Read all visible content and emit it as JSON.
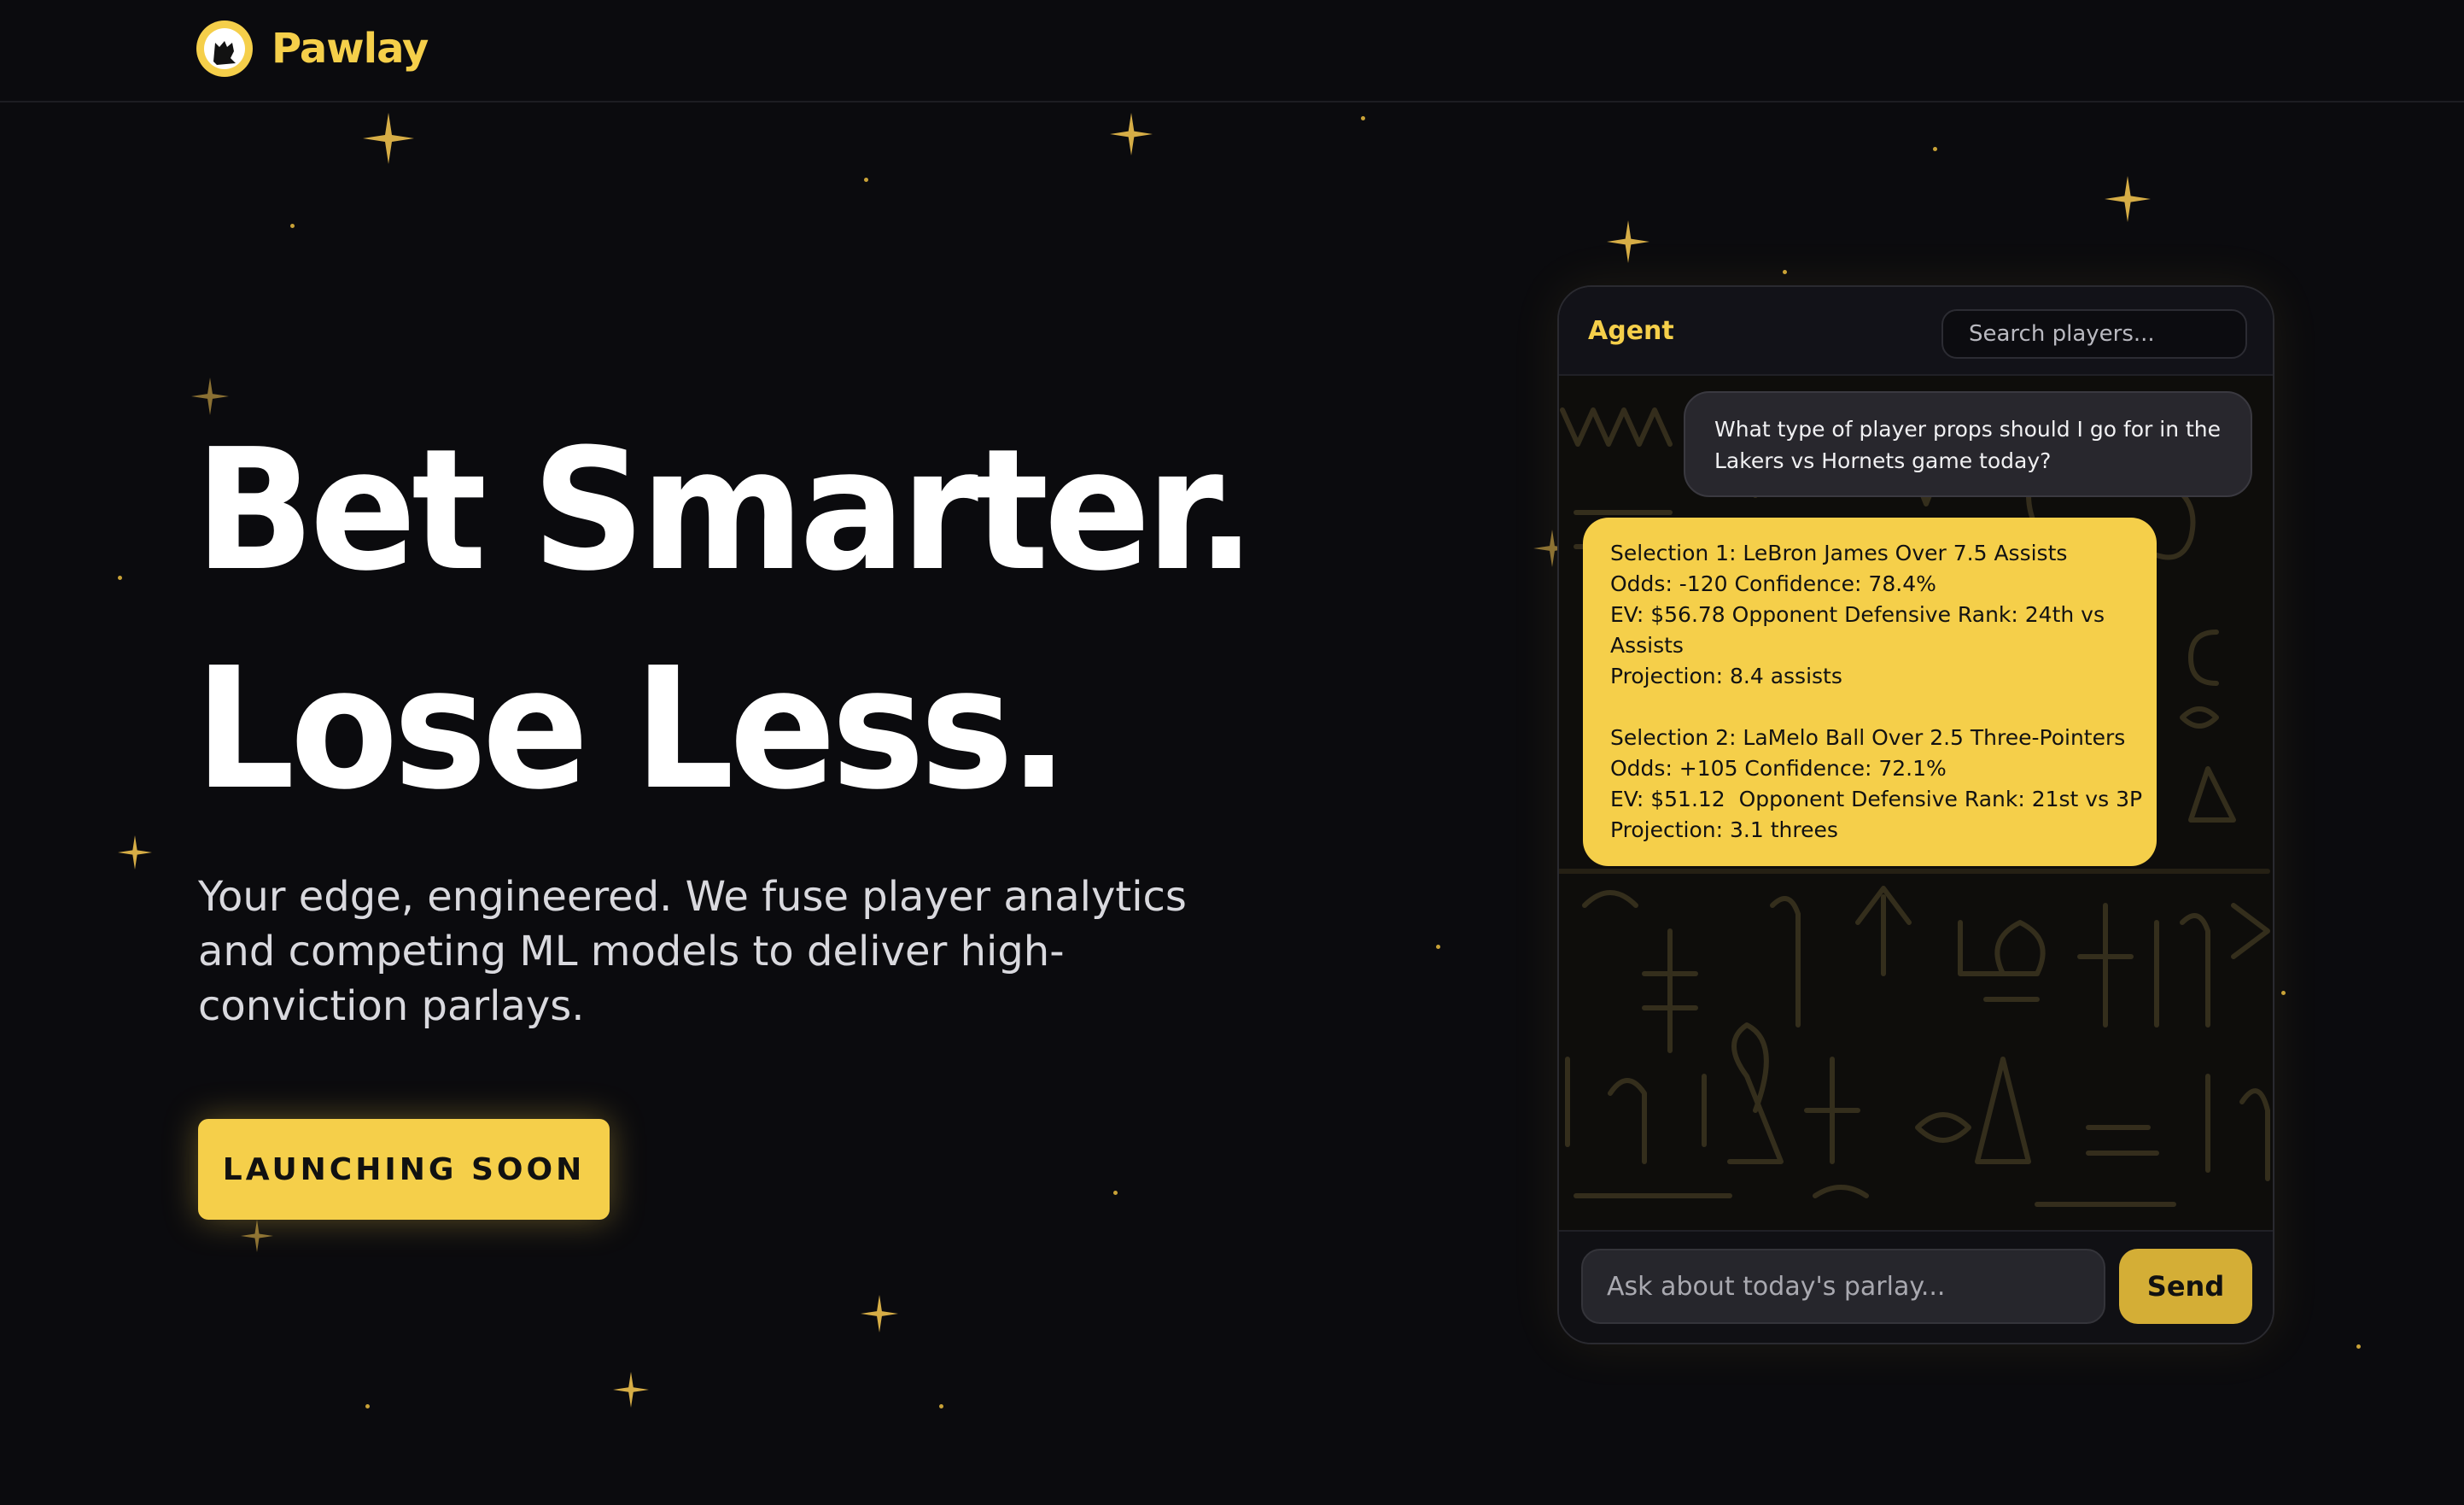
{
  "brand": {
    "name": "Pawlay",
    "logo_icon": "cat-logo-icon"
  },
  "hero": {
    "headline_line1": "Bet Smarter.",
    "headline_line2": "Lose Less.",
    "subtitle": "Your edge, engineered. We fuse player analytics and competing ML models to deliver high-conviction parlays.",
    "cta_label": "LAUNCHING SOON"
  },
  "chat": {
    "agent_label": "Agent",
    "search_placeholder": "Search players...",
    "user_message": "What type of player props should I go for in the Lakers vs Hornets game today?",
    "agent_lines": [
      "Selection 1: LeBron James Over 7.5 Assists",
      "Odds: -120 Confidence: 78.4%",
      "EV: $56.78 Opponent Defensive Rank: 24th vs",
      "Assists",
      "Projection: 8.4 assists",
      "",
      "Selection 2: LaMelo Ball Over 2.5 Three-Pointers",
      "Odds: +105 Confidence: 72.1%",
      "EV: $51.12  Opponent Defensive Rank: 21st vs 3P",
      "Projection: 3.1 threes"
    ],
    "input_placeholder": "Ask about today's parlay...",
    "send_label": "Send"
  },
  "colors": {
    "accent": "#f5cf4a",
    "background": "#0b0b0e",
    "send_button": "#d4ae36"
  }
}
